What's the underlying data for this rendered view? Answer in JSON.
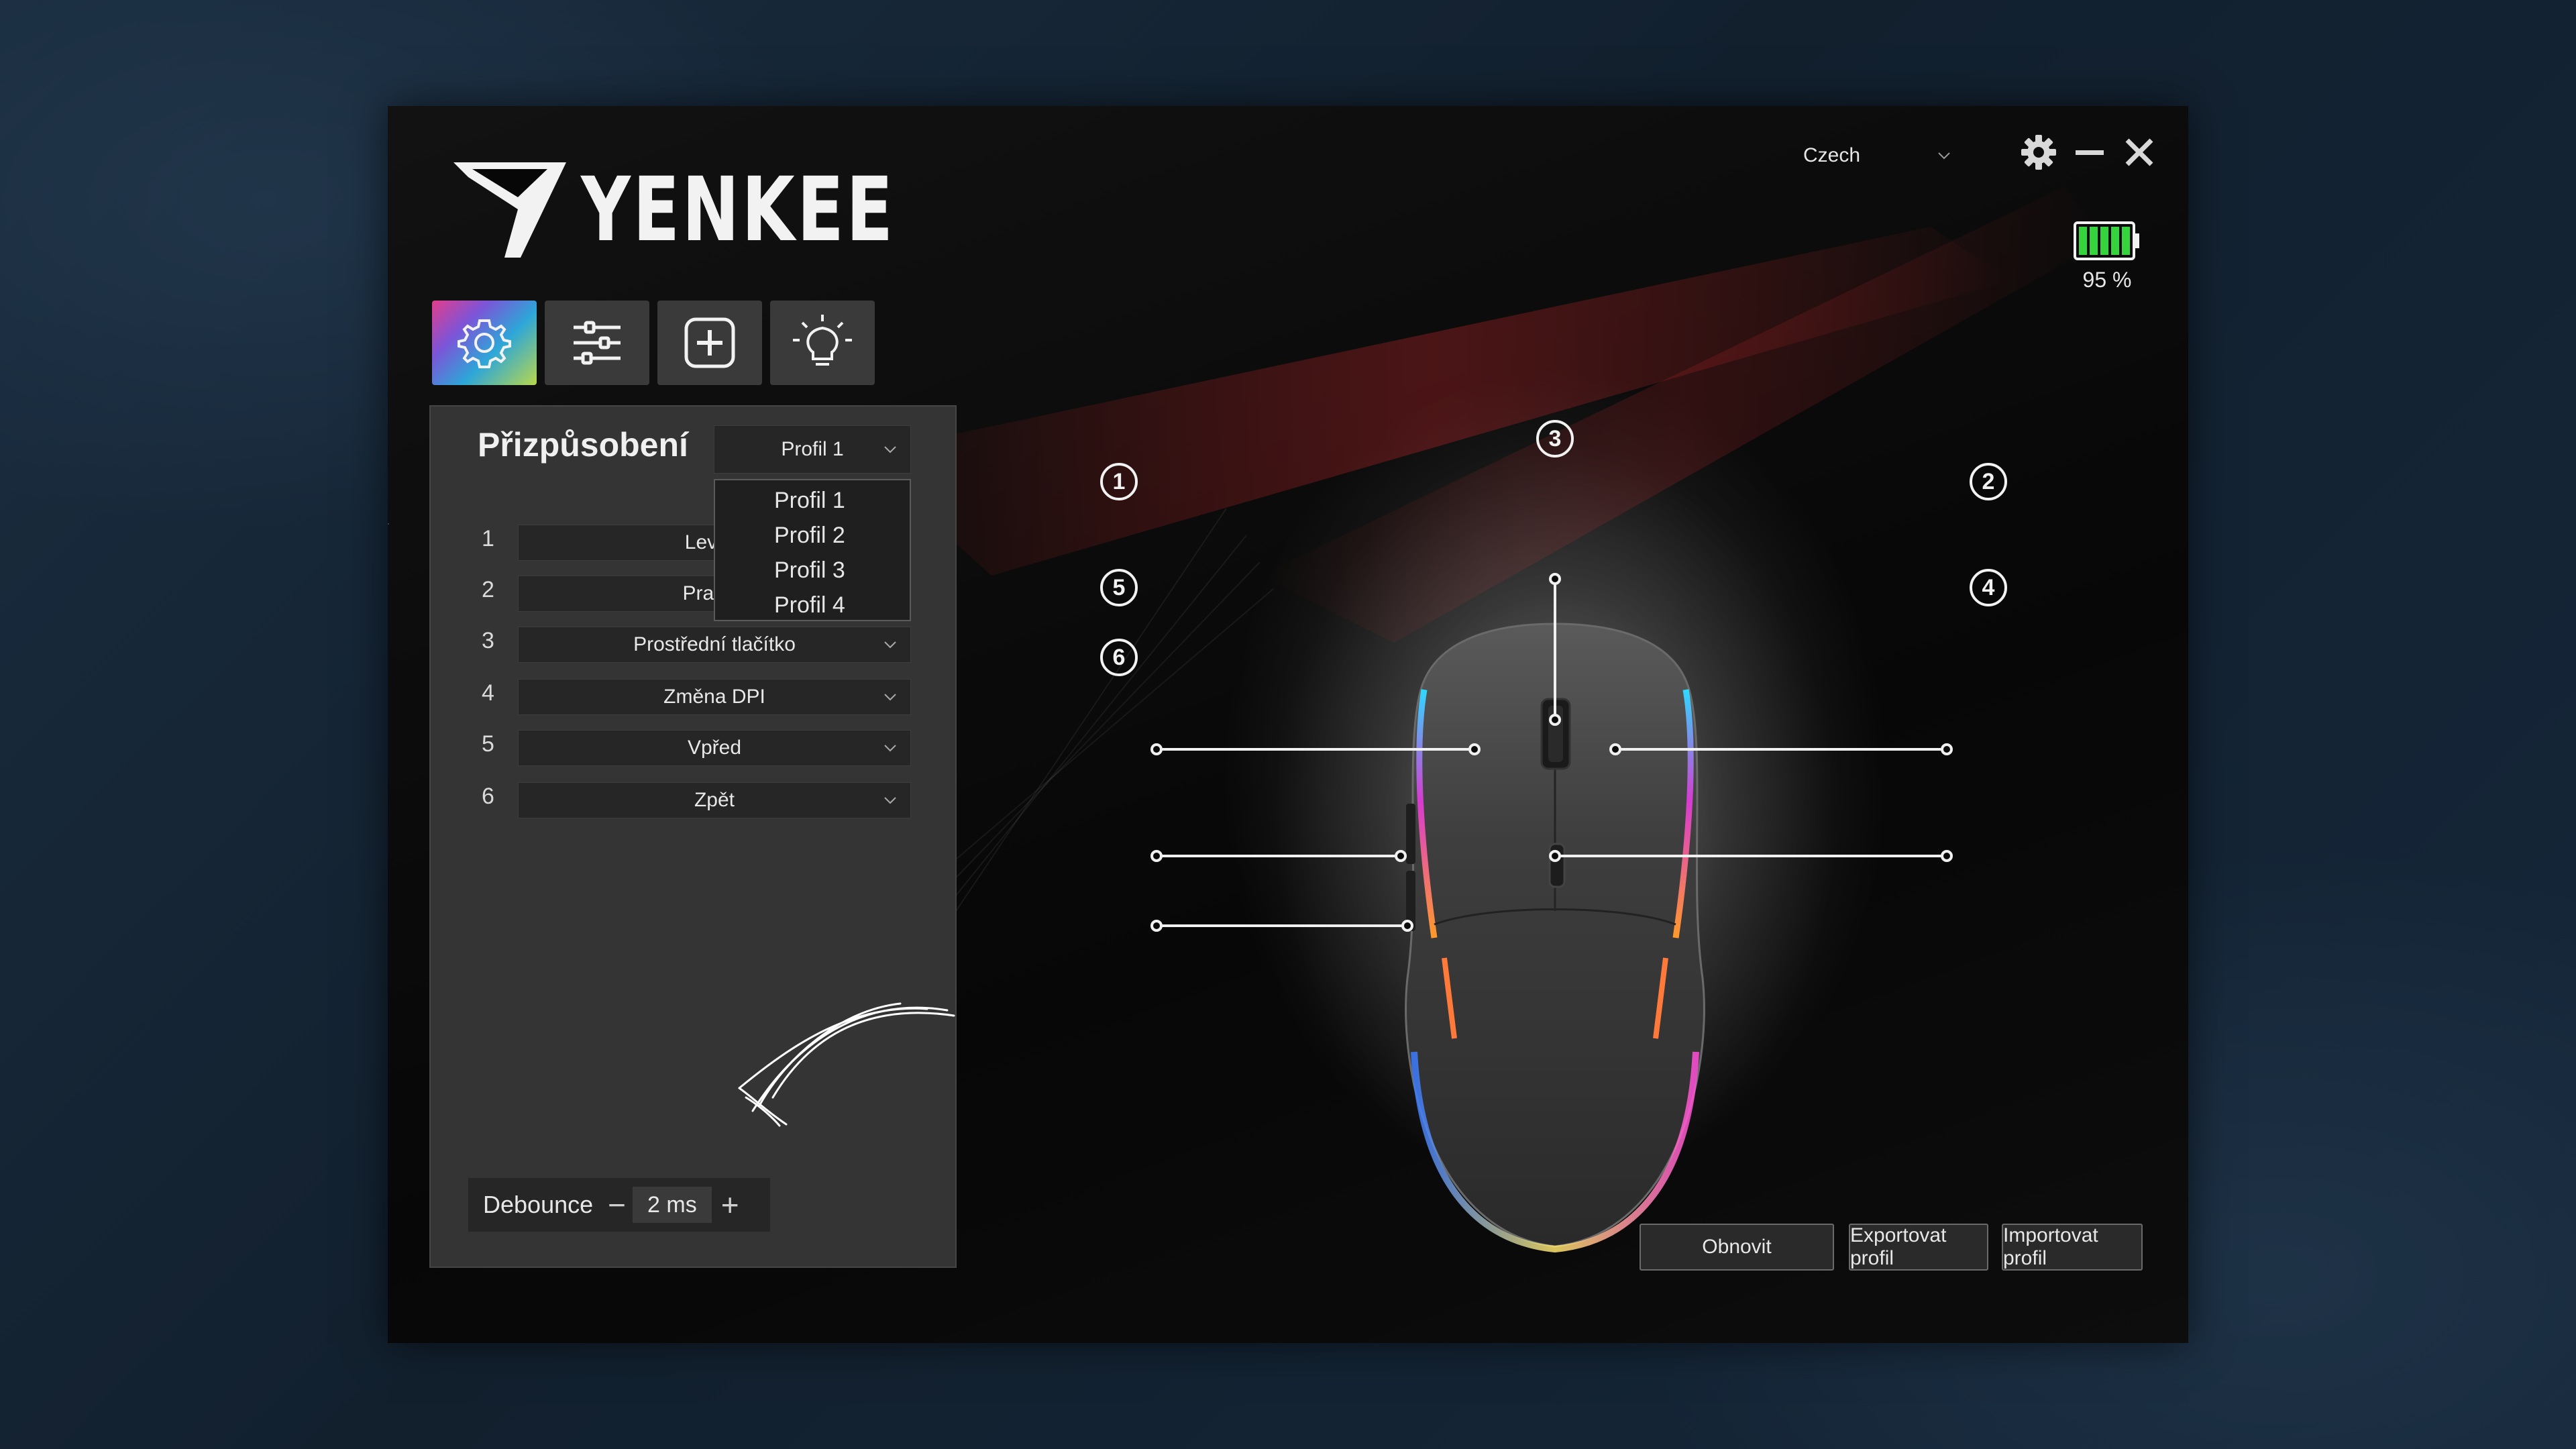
{
  "brand": {
    "name": "YENKEE"
  },
  "header": {
    "language": "Czech"
  },
  "battery": {
    "percent_label": "95 %",
    "level": 0.95
  },
  "tabs": [
    {
      "icon": "gear-icon",
      "active": true
    },
    {
      "icon": "sliders-icon",
      "active": false
    },
    {
      "icon": "plus-icon",
      "active": false
    },
    {
      "icon": "lightbulb-icon",
      "active": false
    }
  ],
  "panel": {
    "title": "Přizpůsobení",
    "profile_selected": "Profil 1",
    "profile_options": [
      "Profil 1",
      "Profil 2",
      "Profil 3",
      "Profil 4"
    ],
    "buttons": [
      {
        "num": "1",
        "value": "Levé tl"
      },
      {
        "num": "2",
        "value": "Pravé t"
      },
      {
        "num": "3",
        "value": "Prostřední tlačítko"
      },
      {
        "num": "4",
        "value": "Změna DPI"
      },
      {
        "num": "5",
        "value": "Vpřed"
      },
      {
        "num": "6",
        "value": "Zpět"
      }
    ],
    "debounce": {
      "label": "Debounce",
      "value": "2 ms",
      "minus": "−",
      "plus": "+"
    }
  },
  "callouts": [
    "1",
    "2",
    "3",
    "4",
    "5",
    "6"
  ],
  "actions": {
    "reset": "Obnovit",
    "export": "Exportovat profil",
    "import": "Importovat profil"
  },
  "colors": {
    "accent_active_tab": "#7b55d8",
    "battery_green": "#35d33c"
  }
}
